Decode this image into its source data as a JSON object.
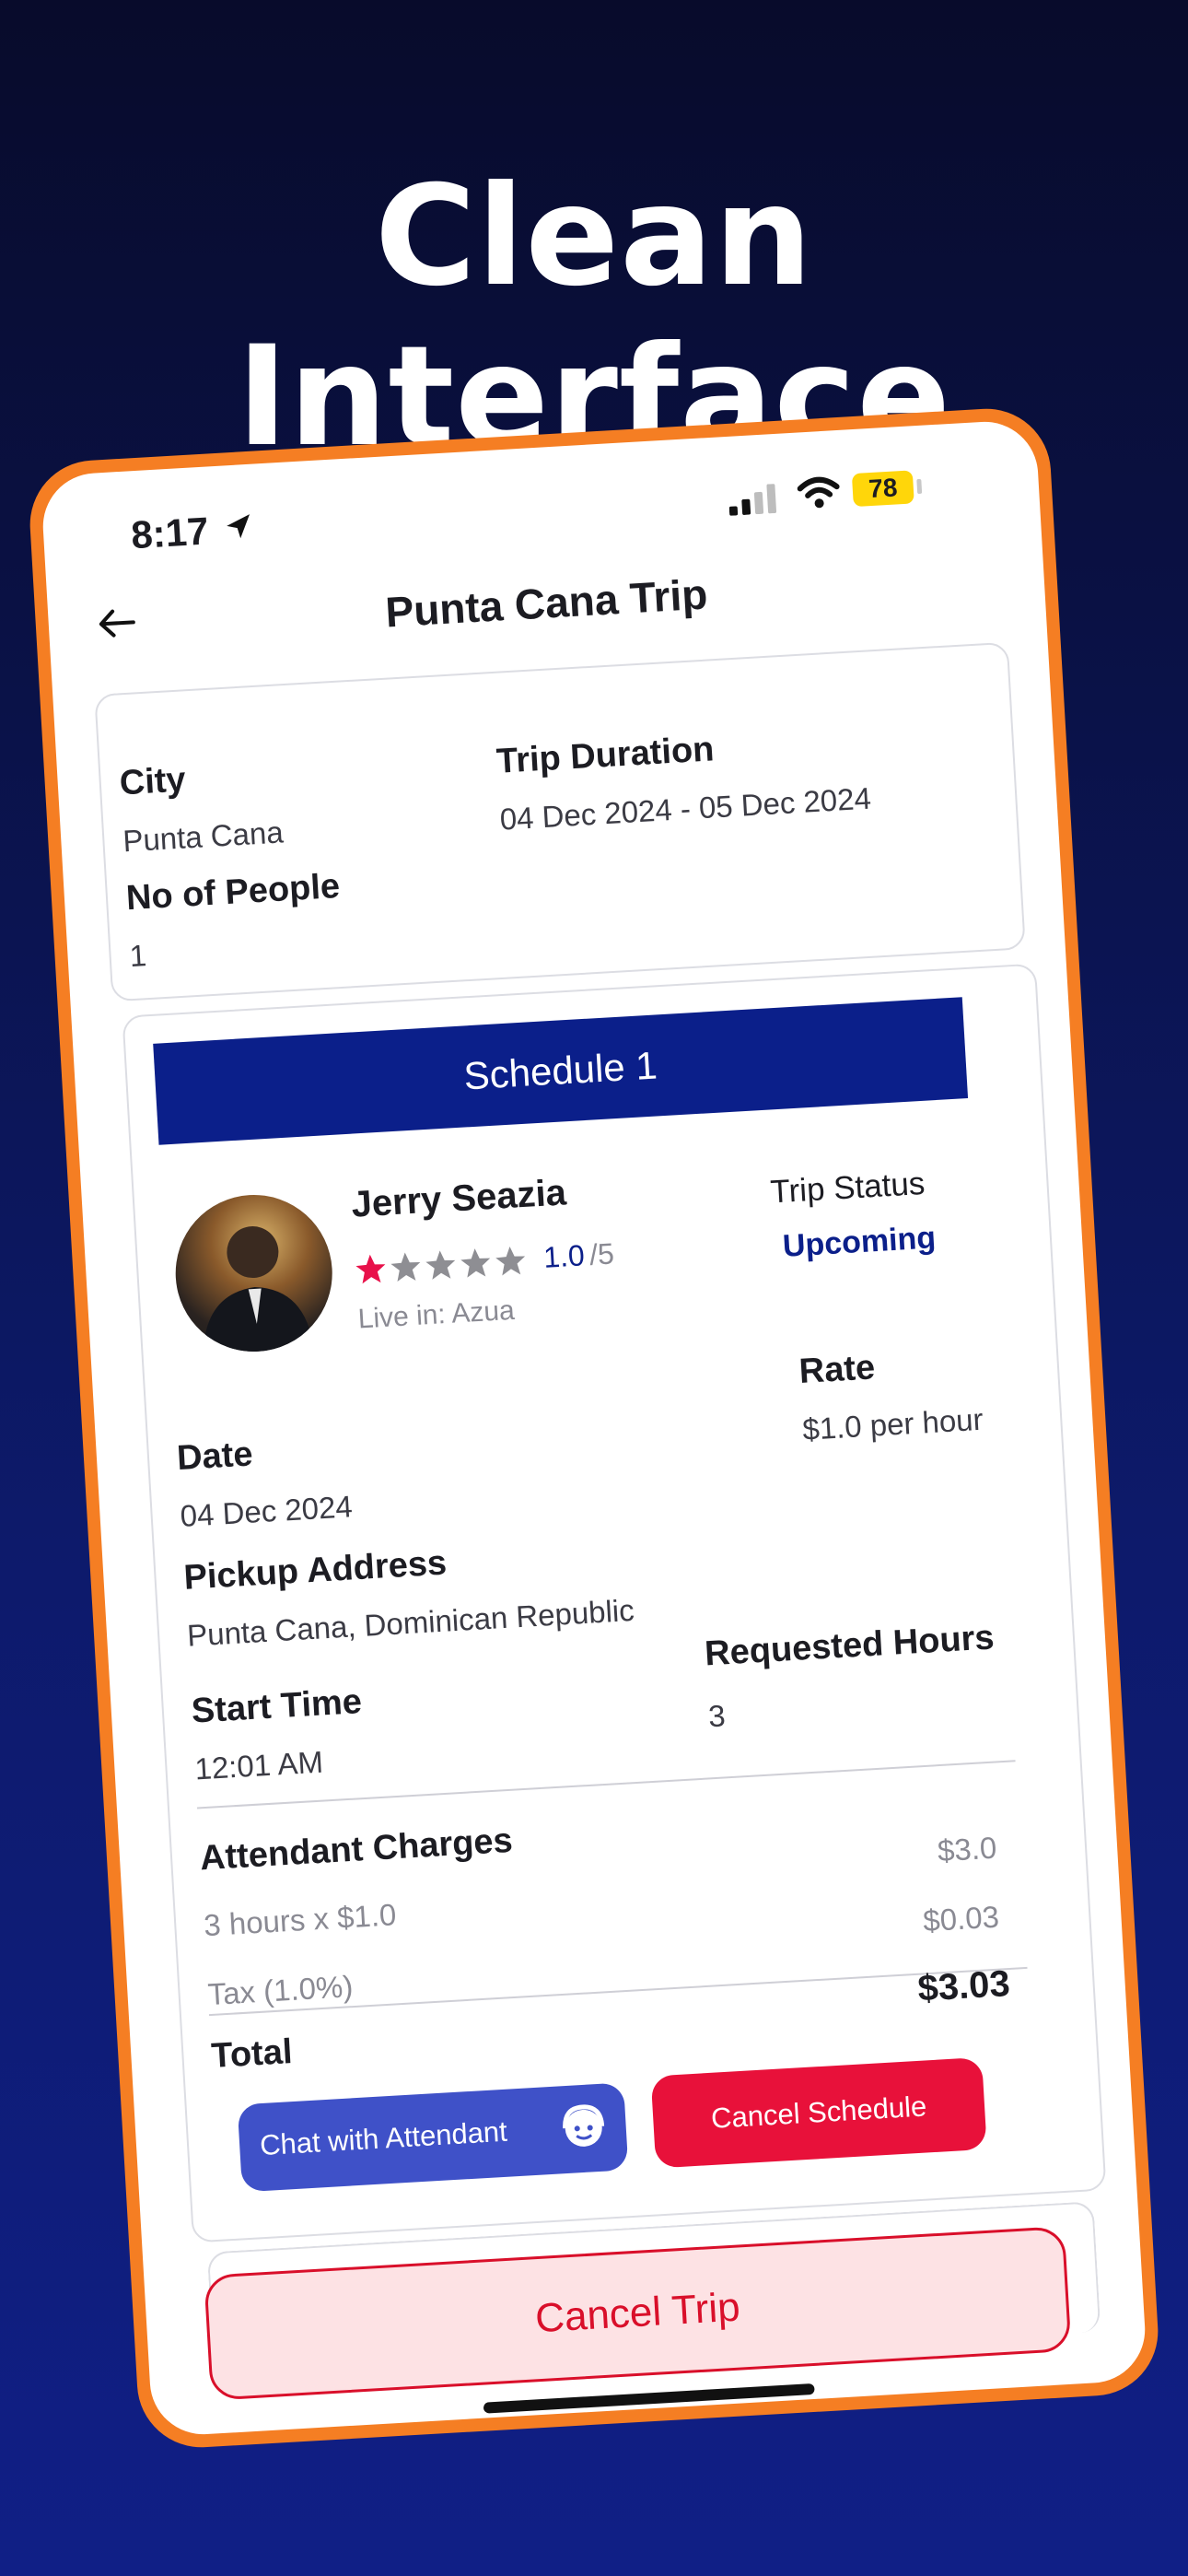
{
  "headline": "Clean Interface",
  "status_bar": {
    "time": "8:17",
    "battery": "78"
  },
  "header": {
    "title": "Punta Cana Trip"
  },
  "trip_info": {
    "city_label": "City",
    "city_value": "Punta Cana",
    "duration_label": "Trip Duration",
    "duration_value": "04 Dec 2024 - 05 Dec 2024",
    "people_label": "No of People",
    "people_value": "1"
  },
  "schedule": {
    "header": "Schedule 1",
    "attendant_name": "Jerry Seazia",
    "rating": "1.0",
    "rating_max": "/5",
    "rating_stars_filled": 1,
    "lives_in": "Live in: Azua",
    "trip_status_label": "Trip Status",
    "trip_status_value": "Upcoming",
    "rate_label": "Rate",
    "rate_value": "$1.0 per hour",
    "date_label": "Date",
    "date_value": "04 Dec 2024",
    "pickup_label": "Pickup Address",
    "pickup_value": "Punta Cana, Dominican Republic",
    "start_label": "Start Time",
    "start_value": "12:01 AM",
    "hours_label": "Requested Hours",
    "hours_value": "3",
    "charges_label": "Attendant Charges",
    "charges_line_label": "3 hours x $1.0",
    "charges_line_value": "$3.0",
    "tax_label": "Tax (1.0%)",
    "tax_value": "$0.03",
    "total_label": "Total",
    "total_value": "$3.03",
    "chat_button": "Chat with Attendant",
    "cancel_schedule_button": "Cancel Schedule"
  },
  "cancel_trip_button": "Cancel Trip",
  "colors": {
    "accent_orange": "#f57e23",
    "primary_blue": "#0b1f8a",
    "danger_red": "#e8113a",
    "chat_blue": "#3f51c8",
    "star_pink": "#e8114a"
  }
}
